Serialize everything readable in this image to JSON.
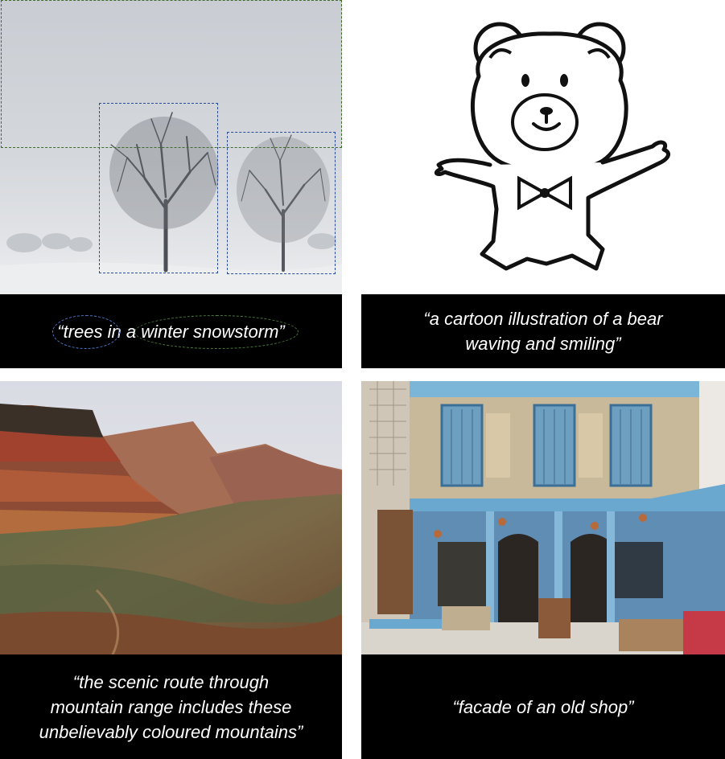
{
  "panels": [
    {
      "id": "snow",
      "image_subject": "trees-in-snowstorm",
      "caption_parts": [
        "“",
        "trees",
        " in a ",
        "winter snowstorm",
        "”"
      ]
    },
    {
      "id": "bear",
      "image_subject": "cartoon-bear",
      "caption_line1": "“a cartoon illustration of a bear",
      "caption_line2": "waving and smiling”"
    },
    {
      "id": "mountains",
      "image_subject": "colourful-mountains",
      "caption_line1": "“the scenic route through",
      "caption_line2": "mountain range includes these",
      "caption_line3": "unbelievably coloured mountains”"
    },
    {
      "id": "shop",
      "image_subject": "old-shop-facade",
      "caption_line1": "“facade of an old shop”"
    }
  ],
  "colors": {
    "region_blue": "#2a4c9a",
    "region_green": "#3f6a2a",
    "caption_bg": "#000000",
    "caption_text": "#ffffff"
  }
}
